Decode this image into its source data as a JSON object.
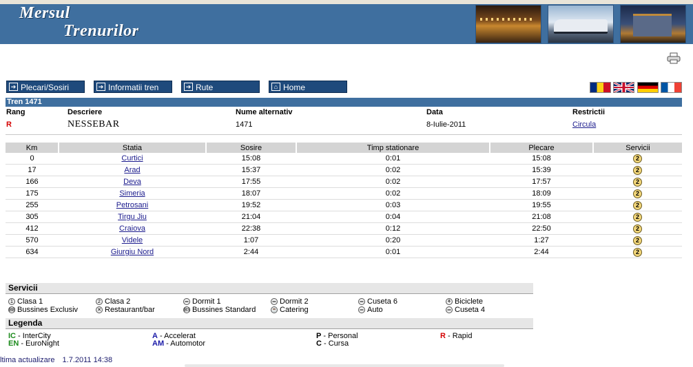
{
  "header": {
    "logo_line1": "Mersul",
    "logo_line2": "Trenurilor"
  },
  "nav": {
    "buttons": [
      {
        "label": "Plecari/Sosiri"
      },
      {
        "label": "Informatii tren"
      },
      {
        "label": "Rute"
      },
      {
        "label": "Home"
      }
    ]
  },
  "flags": [
    "romanian-flag",
    "uk-flag",
    "german-flag",
    "french-flag"
  ],
  "train": {
    "bar_title": "Tren  1471",
    "headers": {
      "rang": "Rang",
      "descriere": "Descriere",
      "nume": "Nume alternativ",
      "data": "Data",
      "restrictii": "Restrictii"
    },
    "rang": "R",
    "descriere": "NESSEBAR",
    "nume": "1471",
    "data": "8-Iulie-2011",
    "restrictii": "Circula"
  },
  "schedule": {
    "columns": [
      "Km",
      "Statia",
      "Sosire",
      "Timp stationare",
      "Plecare",
      "Servicii"
    ],
    "rows": [
      {
        "km": "0",
        "statia": "Curtici",
        "sosire": "15:08",
        "timp": "0:01",
        "plecare": "15:08",
        "svc": "2"
      },
      {
        "km": "17",
        "statia": "Arad",
        "sosire": "15:37",
        "timp": "0:02",
        "plecare": "15:39",
        "svc": "2"
      },
      {
        "km": "166",
        "statia": "Deva",
        "sosire": "17:55",
        "timp": "0:02",
        "plecare": "17:57",
        "svc": "2"
      },
      {
        "km": "175",
        "statia": "Simeria",
        "sosire": "18:07",
        "timp": "0:02",
        "plecare": "18:09",
        "svc": "2"
      },
      {
        "km": "255",
        "statia": "Petrosani",
        "sosire": "19:52",
        "timp": "0:03",
        "plecare": "19:55",
        "svc": "2"
      },
      {
        "km": "305",
        "statia": "Tirgu Jiu",
        "sosire": "21:04",
        "timp": "0:04",
        "plecare": "21:08",
        "svc": "2"
      },
      {
        "km": "412",
        "statia": "Craiova",
        "sosire": "22:38",
        "timp": "0:12",
        "plecare": "22:50",
        "svc": "2"
      },
      {
        "km": "570",
        "statia": "Videle",
        "sosire": "1:07",
        "timp": "0:20",
        "plecare": "1:27",
        "svc": "2"
      },
      {
        "km": "634",
        "statia": "Giurgiu Nord",
        "sosire": "2:44",
        "timp": "0:01",
        "plecare": "2:44",
        "svc": "2"
      }
    ]
  },
  "servicii": {
    "title": "Servicii",
    "items": [
      {
        "icon": "1",
        "label": "Clasa 1"
      },
      {
        "icon": "2",
        "label": "Clasa 2"
      },
      {
        "icon": "═",
        "label": "Dormit 1"
      },
      {
        "icon": "═",
        "label": "Dormit 2"
      },
      {
        "icon": "═",
        "label": "Cuseta 6"
      },
      {
        "icon": "⚘",
        "label": "Biciclete"
      },
      {
        "icon": "BE",
        "label": "Bussines Exclusiv"
      },
      {
        "icon": "✕",
        "label": "Restaurant/bar"
      },
      {
        "icon": "BS",
        "label": "Bussines Standard"
      },
      {
        "icon": "☕",
        "label": "Catering"
      },
      {
        "icon": "═",
        "label": "Auto"
      },
      {
        "icon": "═",
        "label": "Cuseta 4"
      }
    ]
  },
  "legenda": {
    "title": "Legenda",
    "items": [
      {
        "code": "IC",
        "desc": " - InterCity"
      },
      {
        "code": "A",
        "desc": " - Accelerat"
      },
      {
        "code": "P",
        "desc": " - Personal"
      },
      {
        "code": "R",
        "desc": " - Rapid"
      },
      {
        "code": "EN",
        "desc": " - EuroNight"
      },
      {
        "code": "AM",
        "desc": " - Automotor"
      },
      {
        "code": "C",
        "desc": " - Cursa"
      }
    ]
  },
  "footer": {
    "label": "ltima actualizare",
    "value": "1.7.2011 14:38"
  },
  "colors": {
    "banner": "#3f6f9f",
    "nav_button": "#1f4a7c",
    "rang_red": "#d40000",
    "legend_green": "#1b8a1b",
    "legend_blue": "#1a1aa8"
  }
}
